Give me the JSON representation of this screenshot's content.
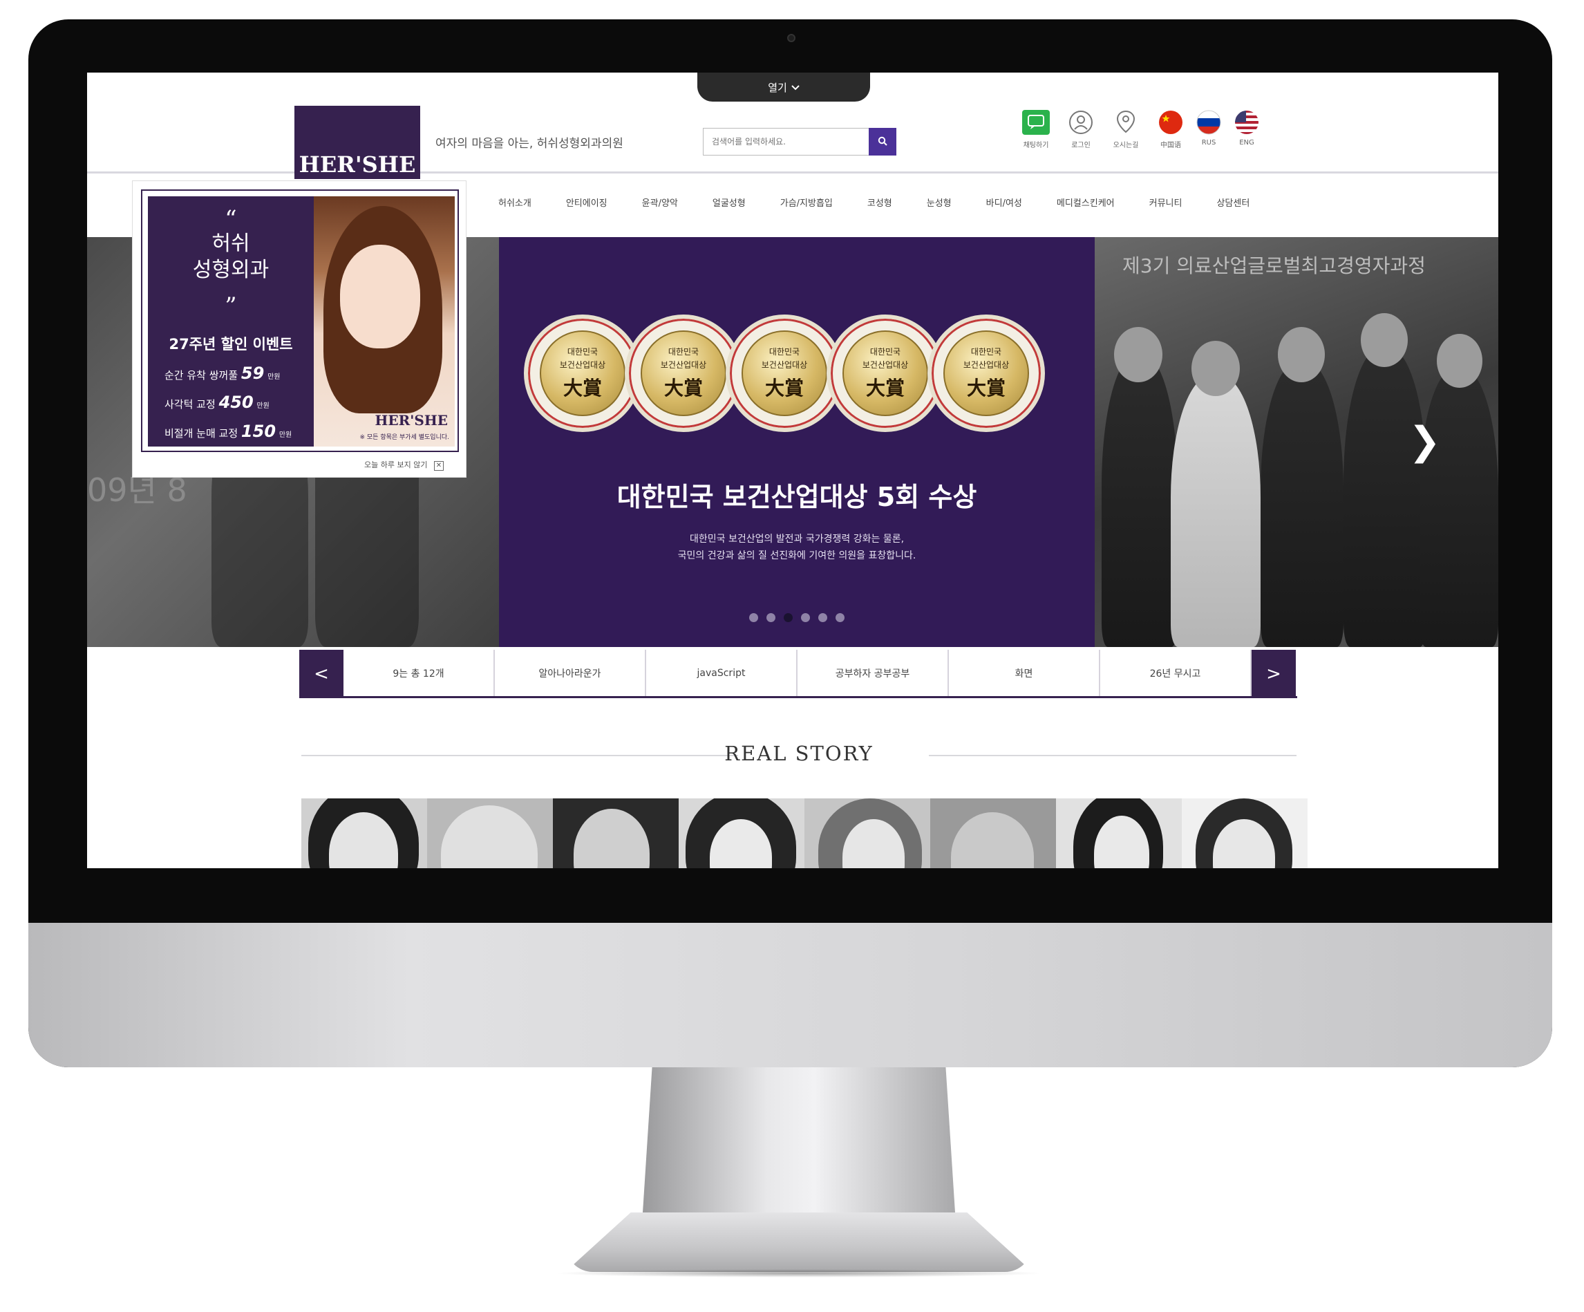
{
  "top_tab": {
    "label": "열기",
    "icon": "chevron-down-icon"
  },
  "header": {
    "logo_text": "HER'SHE",
    "tagline": "여자의 마음을 아는, 허쉬성형외과의원",
    "search": {
      "placeholder": "검색어를 입력하세요.",
      "icon": "search-icon"
    },
    "utilities": [
      {
        "label": "채팅하기",
        "icon": "chat-icon",
        "color": "#2bb24c"
      },
      {
        "label": "로그인",
        "icon": "user-icon"
      },
      {
        "label": "오시는길",
        "icon": "location-pin-icon"
      },
      {
        "label": "中国语",
        "icon": "china-flag-icon"
      },
      {
        "label": "RUS",
        "icon": "russia-flag-icon"
      },
      {
        "label": "ENG",
        "icon": "usa-flag-icon"
      }
    ]
  },
  "nav": [
    "허쉬소개",
    "안티에이징",
    "윤곽/양악",
    "얼굴성형",
    "가슴/지방흡입",
    "코성형",
    "눈성형",
    "바디/여성",
    "메디컬스킨케어",
    "커뮤니티",
    "상담센터"
  ],
  "popup": {
    "name_line1": "허쉬",
    "name_line2": "성형외과",
    "event_title": "27주년 할인 이벤트",
    "offers": [
      {
        "text": "순간 유착 쌍꺼풀",
        "num": "59",
        "unit": "만원"
      },
      {
        "text": "사각턱 교정",
        "num": "450",
        "unit": "만원"
      },
      {
        "text": "비절개 눈매 교정",
        "num": "150",
        "unit": "만원"
      }
    ],
    "brand": "HER'SHE",
    "brand_sub": "※ 모든 항목은 부가세 별도입니다.",
    "close_text": "오늘 하루 보지 않기",
    "close_icon": "close-icon"
  },
  "hero": {
    "left_bg_text": "09년 8",
    "right_bg_text": "제3기 의료산업글로벌최고경영자과정",
    "medal": {
      "line1": "대한민국",
      "line2": "보건산업대상",
      "main": "大賞"
    },
    "medal_count": 5,
    "title": "대한민국 보건산업대상 5회 수상",
    "desc_line1": "대한민국 보건산업의 발전과 국가경쟁력 강화는 물론,",
    "desc_line2": "국민의 건강과 삶의 질 선진화에 기여한 의원을 표창합니다.",
    "dots": 6,
    "active_dot": 3,
    "next_icon": "chevron-right-icon",
    "right_arrow": "❯"
  },
  "tabs": {
    "prev": "<",
    "next": ">",
    "items": [
      "9는 총 12개",
      "알아나아라운가",
      "javaScript",
      "공부하자 공부공부",
      "화면",
      "26년 무시고"
    ]
  },
  "real_story": {
    "title": "REAL STORY"
  },
  "colors": {
    "brand": "#36214f",
    "accent": "#4b3199"
  }
}
